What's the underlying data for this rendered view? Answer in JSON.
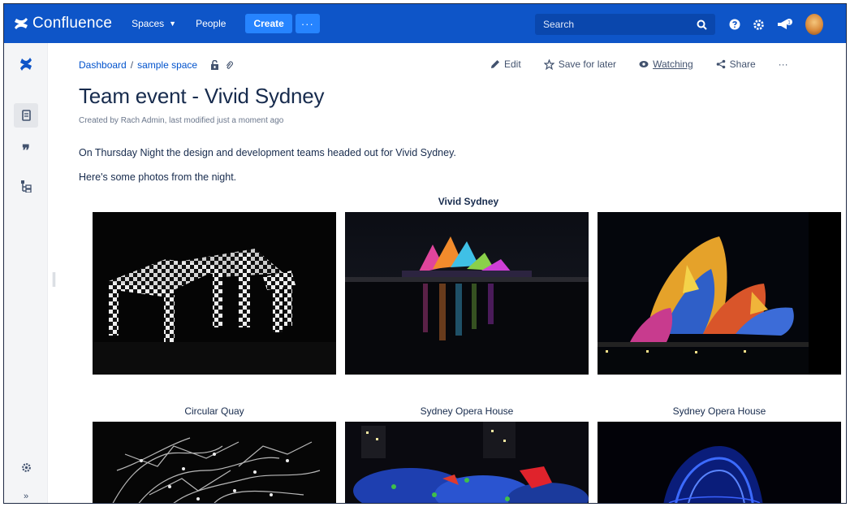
{
  "topnav": {
    "app_name": "Confluence",
    "spaces_label": "Spaces",
    "people_label": "People",
    "create_label": "Create",
    "more_label": "···",
    "search_placeholder": "Search"
  },
  "breadcrumb": {
    "items": [
      "Dashboard",
      "sample space"
    ],
    "separator": "/"
  },
  "actions": {
    "edit": "Edit",
    "save_for_later": "Save for later",
    "watching": "Watching",
    "share": "Share",
    "more": "···"
  },
  "page": {
    "title": "Team event - Vivid Sydney",
    "byline": "Created by Rach Admin, last modified just a moment ago",
    "paragraphs": [
      "On Thursday Night the design and development teams headed out for Vivid Sydney.",
      "Here's some photos from the night."
    ]
  },
  "gallery": {
    "title": "Vivid Sydney",
    "captions": [
      "",
      "",
      "",
      "Circular Quay",
      "Sydney Opera House",
      "Sydney Opera House"
    ]
  },
  "colors": {
    "nav_bg": "#0e55c8",
    "create_bg": "#2684ff",
    "link": "#0052cc",
    "text": "#172b4d"
  },
  "icons": {
    "sidebar": [
      "confluence-logo-icon",
      "pages-icon",
      "blog-quote-icon",
      "page-tree-icon",
      "settings-icon",
      "expand-sidebar-icon"
    ],
    "nav": [
      "search-icon",
      "help-icon",
      "settings-icon",
      "notifications-icon"
    ]
  }
}
